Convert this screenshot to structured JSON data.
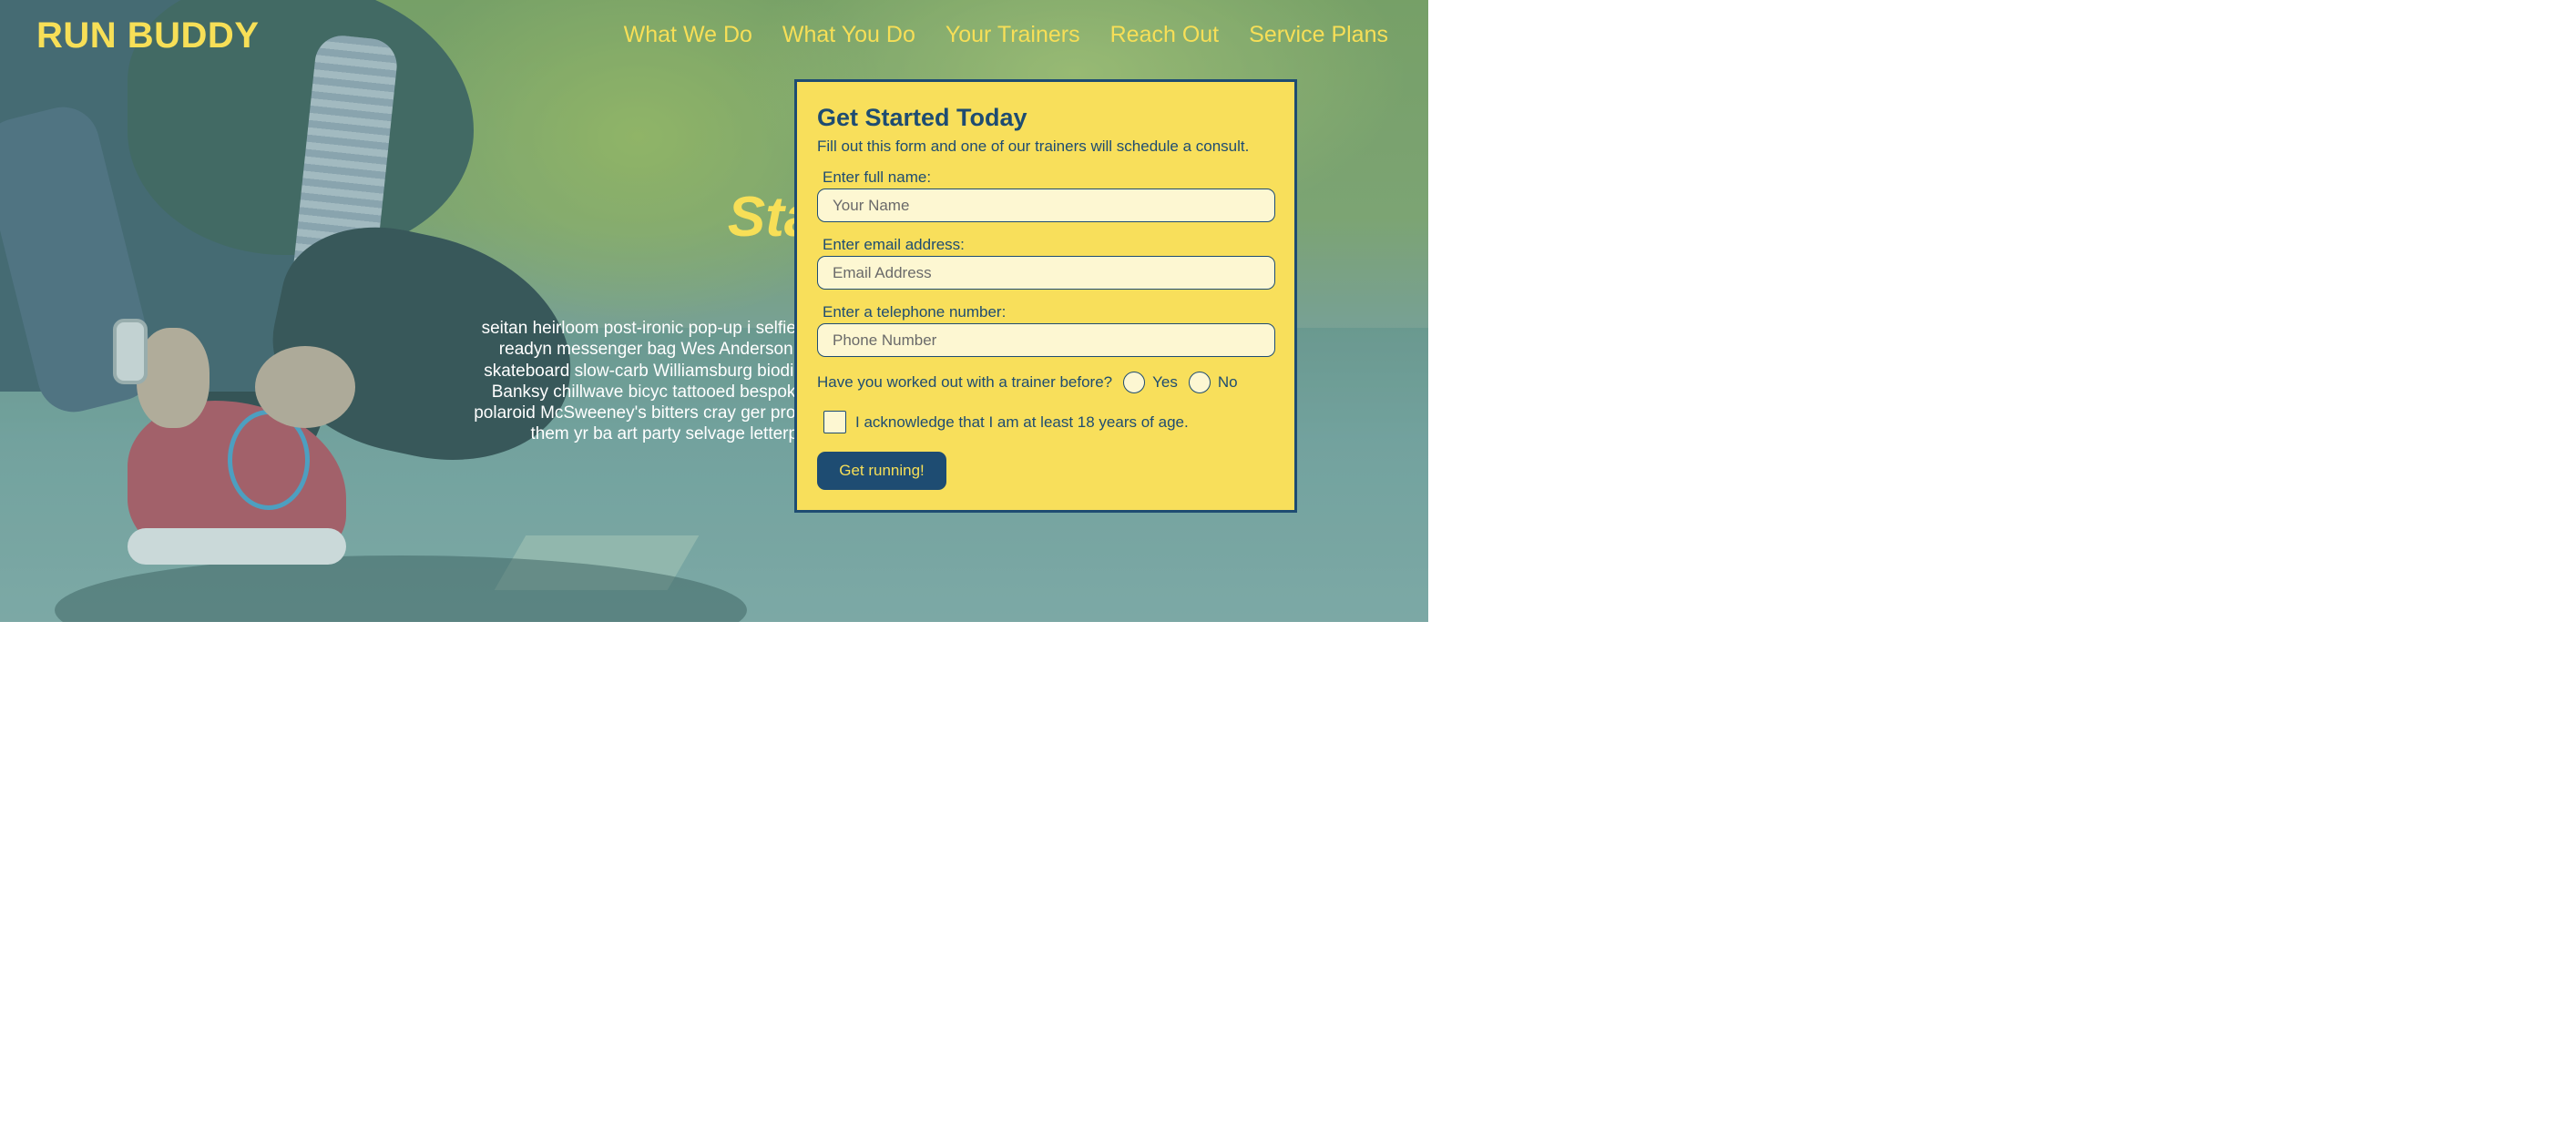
{
  "brand": {
    "logo": "RUN BUDDY"
  },
  "nav": {
    "items": [
      "What We Do",
      "What You Do",
      "Your Trainers",
      "Reach Out",
      "Service Plans"
    ]
  },
  "hero": {
    "title": "Start Bu H",
    "body": "seitan heirloom post-ironic pop-up i selfies fashion axe occupy readyn messenger bag Wes Anderson Sc church-key lo-fi skateboard slow-carb Williamsburg biodiesel fixie farm XOXO Banksy chillwave bicyc tattooed bespoke irony mumblecore polaroid McSweeney's bitters cray ger probably haven't heard of them yr ba art party selvage letterpress High Life."
  },
  "form": {
    "title": "Get Started Today",
    "subtitle": "Fill out this form and one of our trainers will schedule a consult.",
    "name_label": "Enter full name:",
    "name_placeholder": "Your Name",
    "email_label": "Enter email address:",
    "email_placeholder": "Email Address",
    "phone_label": "Enter a telephone number:",
    "phone_placeholder": "Phone Number",
    "trainer_question": "Have you worked out with a trainer before?",
    "yes_label": "Yes",
    "no_label": "No",
    "age_ack": "I acknowledge that I am at least 18 years of age.",
    "submit_label": "Get running!"
  },
  "colors": {
    "accent": "#f7df57",
    "navy": "#1e4c72",
    "input_bg": "#fdf7d2"
  }
}
